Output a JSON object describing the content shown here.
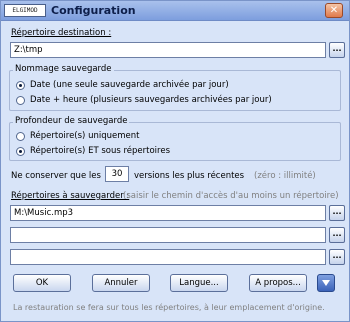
{
  "window": {
    "app_badge": "ELGIMOD",
    "title": "Configuration",
    "close_label": "✕"
  },
  "destination": {
    "label": "Répertoire destination :",
    "value": "Z:\\tmp",
    "browse_label": "..."
  },
  "naming": {
    "legend": "Nommage sauvegarde",
    "options": [
      {
        "label": "Date (une seule sauvegarde archivée par jour)",
        "selected": true
      },
      {
        "label": "Date + heure (plusieurs sauvegardes archivées par jour)",
        "selected": false
      }
    ]
  },
  "depth": {
    "legend": "Profondeur de sauvegarde",
    "options": [
      {
        "label": "Répertoire(s) uniquement",
        "selected": false
      },
      {
        "label": "Répertoire(s) ET sous répertoires",
        "selected": true
      }
    ]
  },
  "versions": {
    "prefix": "Ne conserver que les",
    "value": "30",
    "suffix": "versions les plus récentes",
    "hint": "(zéro : illimité)"
  },
  "sources": {
    "label": "Répertoires à sauvegarder :",
    "hint": "(saisir le chemin d'accès d'au moins un répertoire)",
    "entries": [
      "M:\\Music.mp3",
      "",
      ""
    ],
    "browse_label": "..."
  },
  "buttons": {
    "ok": "OK",
    "cancel": "Annuler",
    "language": "Langue...",
    "about": "A propos..."
  },
  "footer": "La restauration se fera sur tous les répertoires, à leur emplacement d'origine."
}
